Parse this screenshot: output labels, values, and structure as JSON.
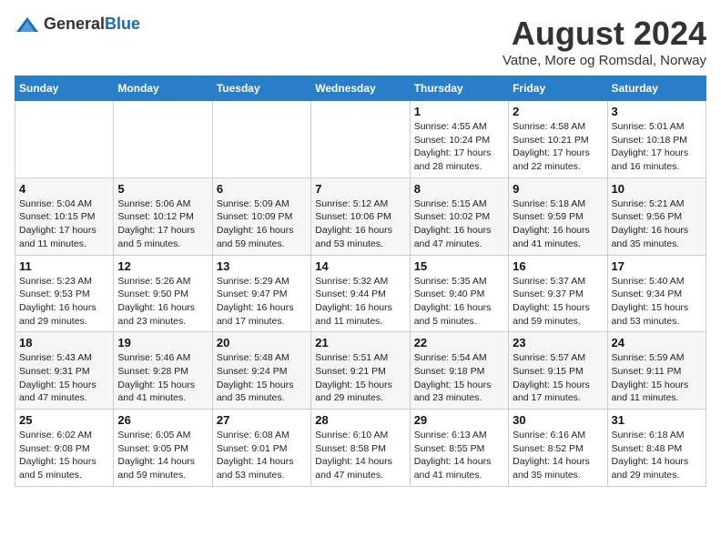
{
  "logo": {
    "general": "General",
    "blue": "Blue"
  },
  "title": "August 2024",
  "subtitle": "Vatne, More og Romsdal, Norway",
  "days_of_week": [
    "Sunday",
    "Monday",
    "Tuesday",
    "Wednesday",
    "Thursday",
    "Friday",
    "Saturday"
  ],
  "weeks": [
    [
      {
        "day": "",
        "info": ""
      },
      {
        "day": "",
        "info": ""
      },
      {
        "day": "",
        "info": ""
      },
      {
        "day": "",
        "info": ""
      },
      {
        "day": "1",
        "info": "Sunrise: 4:55 AM\nSunset: 10:24 PM\nDaylight: 17 hours\nand 28 minutes."
      },
      {
        "day": "2",
        "info": "Sunrise: 4:58 AM\nSunset: 10:21 PM\nDaylight: 17 hours\nand 22 minutes."
      },
      {
        "day": "3",
        "info": "Sunrise: 5:01 AM\nSunset: 10:18 PM\nDaylight: 17 hours\nand 16 minutes."
      }
    ],
    [
      {
        "day": "4",
        "info": "Sunrise: 5:04 AM\nSunset: 10:15 PM\nDaylight: 17 hours\nand 11 minutes."
      },
      {
        "day": "5",
        "info": "Sunrise: 5:06 AM\nSunset: 10:12 PM\nDaylight: 17 hours\nand 5 minutes."
      },
      {
        "day": "6",
        "info": "Sunrise: 5:09 AM\nSunset: 10:09 PM\nDaylight: 16 hours\nand 59 minutes."
      },
      {
        "day": "7",
        "info": "Sunrise: 5:12 AM\nSunset: 10:06 PM\nDaylight: 16 hours\nand 53 minutes."
      },
      {
        "day": "8",
        "info": "Sunrise: 5:15 AM\nSunset: 10:02 PM\nDaylight: 16 hours\nand 47 minutes."
      },
      {
        "day": "9",
        "info": "Sunrise: 5:18 AM\nSunset: 9:59 PM\nDaylight: 16 hours\nand 41 minutes."
      },
      {
        "day": "10",
        "info": "Sunrise: 5:21 AM\nSunset: 9:56 PM\nDaylight: 16 hours\nand 35 minutes."
      }
    ],
    [
      {
        "day": "11",
        "info": "Sunrise: 5:23 AM\nSunset: 9:53 PM\nDaylight: 16 hours\nand 29 minutes."
      },
      {
        "day": "12",
        "info": "Sunrise: 5:26 AM\nSunset: 9:50 PM\nDaylight: 16 hours\nand 23 minutes."
      },
      {
        "day": "13",
        "info": "Sunrise: 5:29 AM\nSunset: 9:47 PM\nDaylight: 16 hours\nand 17 minutes."
      },
      {
        "day": "14",
        "info": "Sunrise: 5:32 AM\nSunset: 9:44 PM\nDaylight: 16 hours\nand 11 minutes."
      },
      {
        "day": "15",
        "info": "Sunrise: 5:35 AM\nSunset: 9:40 PM\nDaylight: 16 hours\nand 5 minutes."
      },
      {
        "day": "16",
        "info": "Sunrise: 5:37 AM\nSunset: 9:37 PM\nDaylight: 15 hours\nand 59 minutes."
      },
      {
        "day": "17",
        "info": "Sunrise: 5:40 AM\nSunset: 9:34 PM\nDaylight: 15 hours\nand 53 minutes."
      }
    ],
    [
      {
        "day": "18",
        "info": "Sunrise: 5:43 AM\nSunset: 9:31 PM\nDaylight: 15 hours\nand 47 minutes."
      },
      {
        "day": "19",
        "info": "Sunrise: 5:46 AM\nSunset: 9:28 PM\nDaylight: 15 hours\nand 41 minutes."
      },
      {
        "day": "20",
        "info": "Sunrise: 5:48 AM\nSunset: 9:24 PM\nDaylight: 15 hours\nand 35 minutes."
      },
      {
        "day": "21",
        "info": "Sunrise: 5:51 AM\nSunset: 9:21 PM\nDaylight: 15 hours\nand 29 minutes."
      },
      {
        "day": "22",
        "info": "Sunrise: 5:54 AM\nSunset: 9:18 PM\nDaylight: 15 hours\nand 23 minutes."
      },
      {
        "day": "23",
        "info": "Sunrise: 5:57 AM\nSunset: 9:15 PM\nDaylight: 15 hours\nand 17 minutes."
      },
      {
        "day": "24",
        "info": "Sunrise: 5:59 AM\nSunset: 9:11 PM\nDaylight: 15 hours\nand 11 minutes."
      }
    ],
    [
      {
        "day": "25",
        "info": "Sunrise: 6:02 AM\nSunset: 9:08 PM\nDaylight: 15 hours\nand 5 minutes."
      },
      {
        "day": "26",
        "info": "Sunrise: 6:05 AM\nSunset: 9:05 PM\nDaylight: 14 hours\nand 59 minutes."
      },
      {
        "day": "27",
        "info": "Sunrise: 6:08 AM\nSunset: 9:01 PM\nDaylight: 14 hours\nand 53 minutes."
      },
      {
        "day": "28",
        "info": "Sunrise: 6:10 AM\nSunset: 8:58 PM\nDaylight: 14 hours\nand 47 minutes."
      },
      {
        "day": "29",
        "info": "Sunrise: 6:13 AM\nSunset: 8:55 PM\nDaylight: 14 hours\nand 41 minutes."
      },
      {
        "day": "30",
        "info": "Sunrise: 6:16 AM\nSunset: 8:52 PM\nDaylight: 14 hours\nand 35 minutes."
      },
      {
        "day": "31",
        "info": "Sunrise: 6:18 AM\nSunset: 8:48 PM\nDaylight: 14 hours\nand 29 minutes."
      }
    ]
  ]
}
